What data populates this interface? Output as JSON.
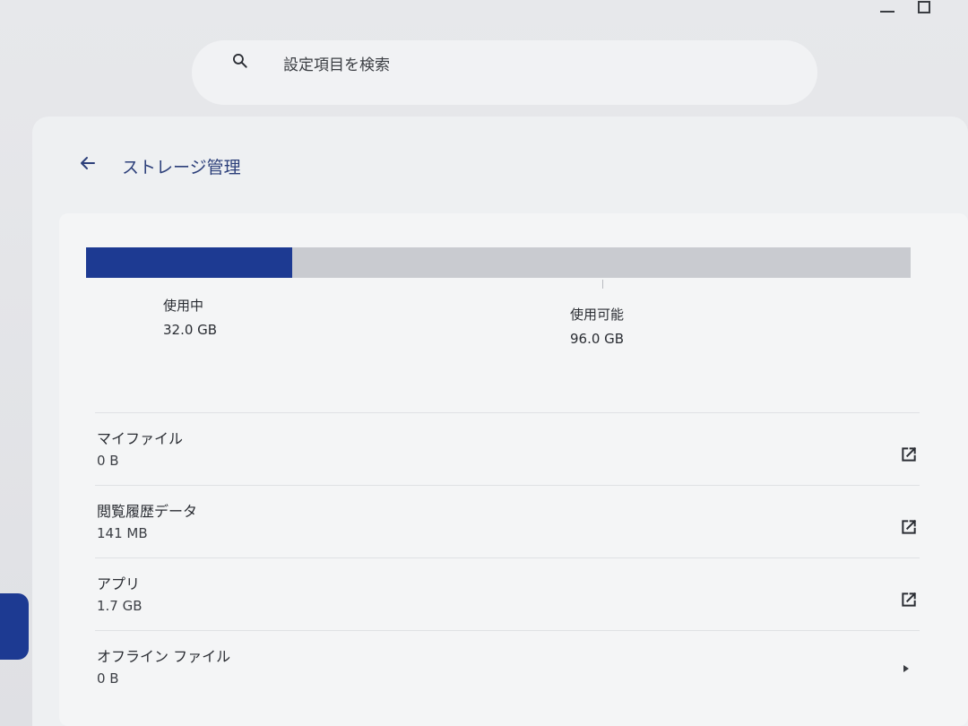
{
  "search": {
    "placeholder": "設定項目を検索",
    "icon": "search-icon"
  },
  "header": {
    "back_icon": "arrow-left-icon",
    "title": "ストレージ管理"
  },
  "storage": {
    "used_fraction": 0.25,
    "used_label": "使用中",
    "used_value": "32.0 GB",
    "available_label": "使用可能",
    "available_value": "96.0 GB",
    "colors": {
      "used": "#1d3a92",
      "available": "#c9cbd0"
    }
  },
  "items": [
    {
      "title": "マイファイル",
      "size": "0 B",
      "icon": "external-link-icon"
    },
    {
      "title": "閲覧履歴データ",
      "size": "141 MB",
      "icon": "external-link-icon"
    },
    {
      "title": "アプリ",
      "size": "1.7 GB",
      "icon": "external-link-icon"
    },
    {
      "title": "オフライン ファイル",
      "size": "0 B",
      "icon": "chevron-right-icon"
    }
  ]
}
